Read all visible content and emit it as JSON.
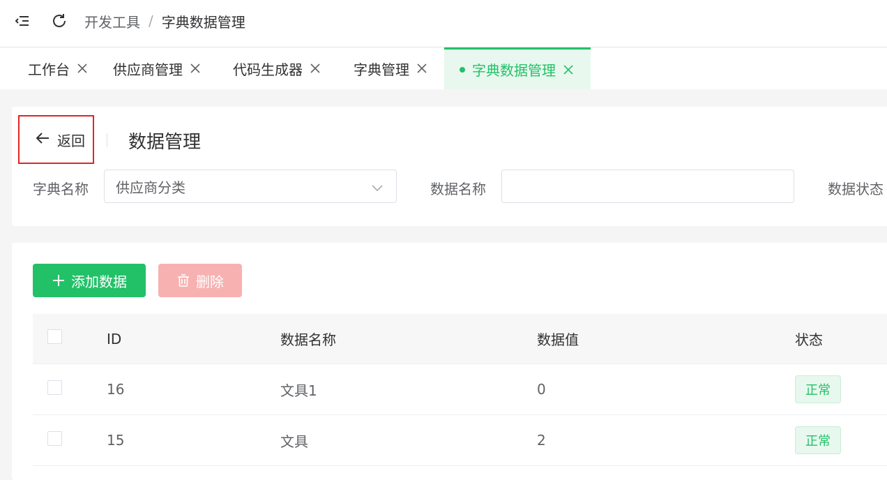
{
  "topbar": {
    "breadcrumb": [
      "开发工具",
      "字典数据管理"
    ],
    "breadcrumb_separator": "/"
  },
  "tabs": [
    {
      "label": "工作台",
      "active": false
    },
    {
      "label": "供应商管理",
      "active": false
    },
    {
      "label": "代码生成器",
      "active": false
    },
    {
      "label": "字典管理",
      "active": false
    },
    {
      "label": "字典数据管理",
      "active": true
    }
  ],
  "header": {
    "back_label": "返回",
    "title": "数据管理"
  },
  "filters": {
    "dict_name_label": "字典名称",
    "dict_name_value": "供应商分类",
    "data_name_label": "数据名称",
    "data_name_value": "",
    "data_status_label": "数据状态"
  },
  "toolbar": {
    "add_label": "添加数据",
    "delete_label": "删除"
  },
  "table": {
    "columns": [
      "ID",
      "数据名称",
      "数据值",
      "状态"
    ],
    "rows": [
      {
        "id": "16",
        "name": "文具1",
        "value": "0",
        "status": "正常"
      },
      {
        "id": "15",
        "name": "文具",
        "value": "2",
        "status": "正常"
      }
    ]
  },
  "colors": {
    "primary": "#22c168",
    "danger_disabled": "#f8b1b1",
    "highlight_border": "#e02424"
  },
  "icons": {
    "menu_toggle": "menu-fold-icon",
    "refresh": "refresh-icon",
    "close": "close-icon",
    "back": "arrow-left-icon",
    "chevron": "chevron-down-icon",
    "add": "plus-icon",
    "delete": "trash-icon"
  }
}
